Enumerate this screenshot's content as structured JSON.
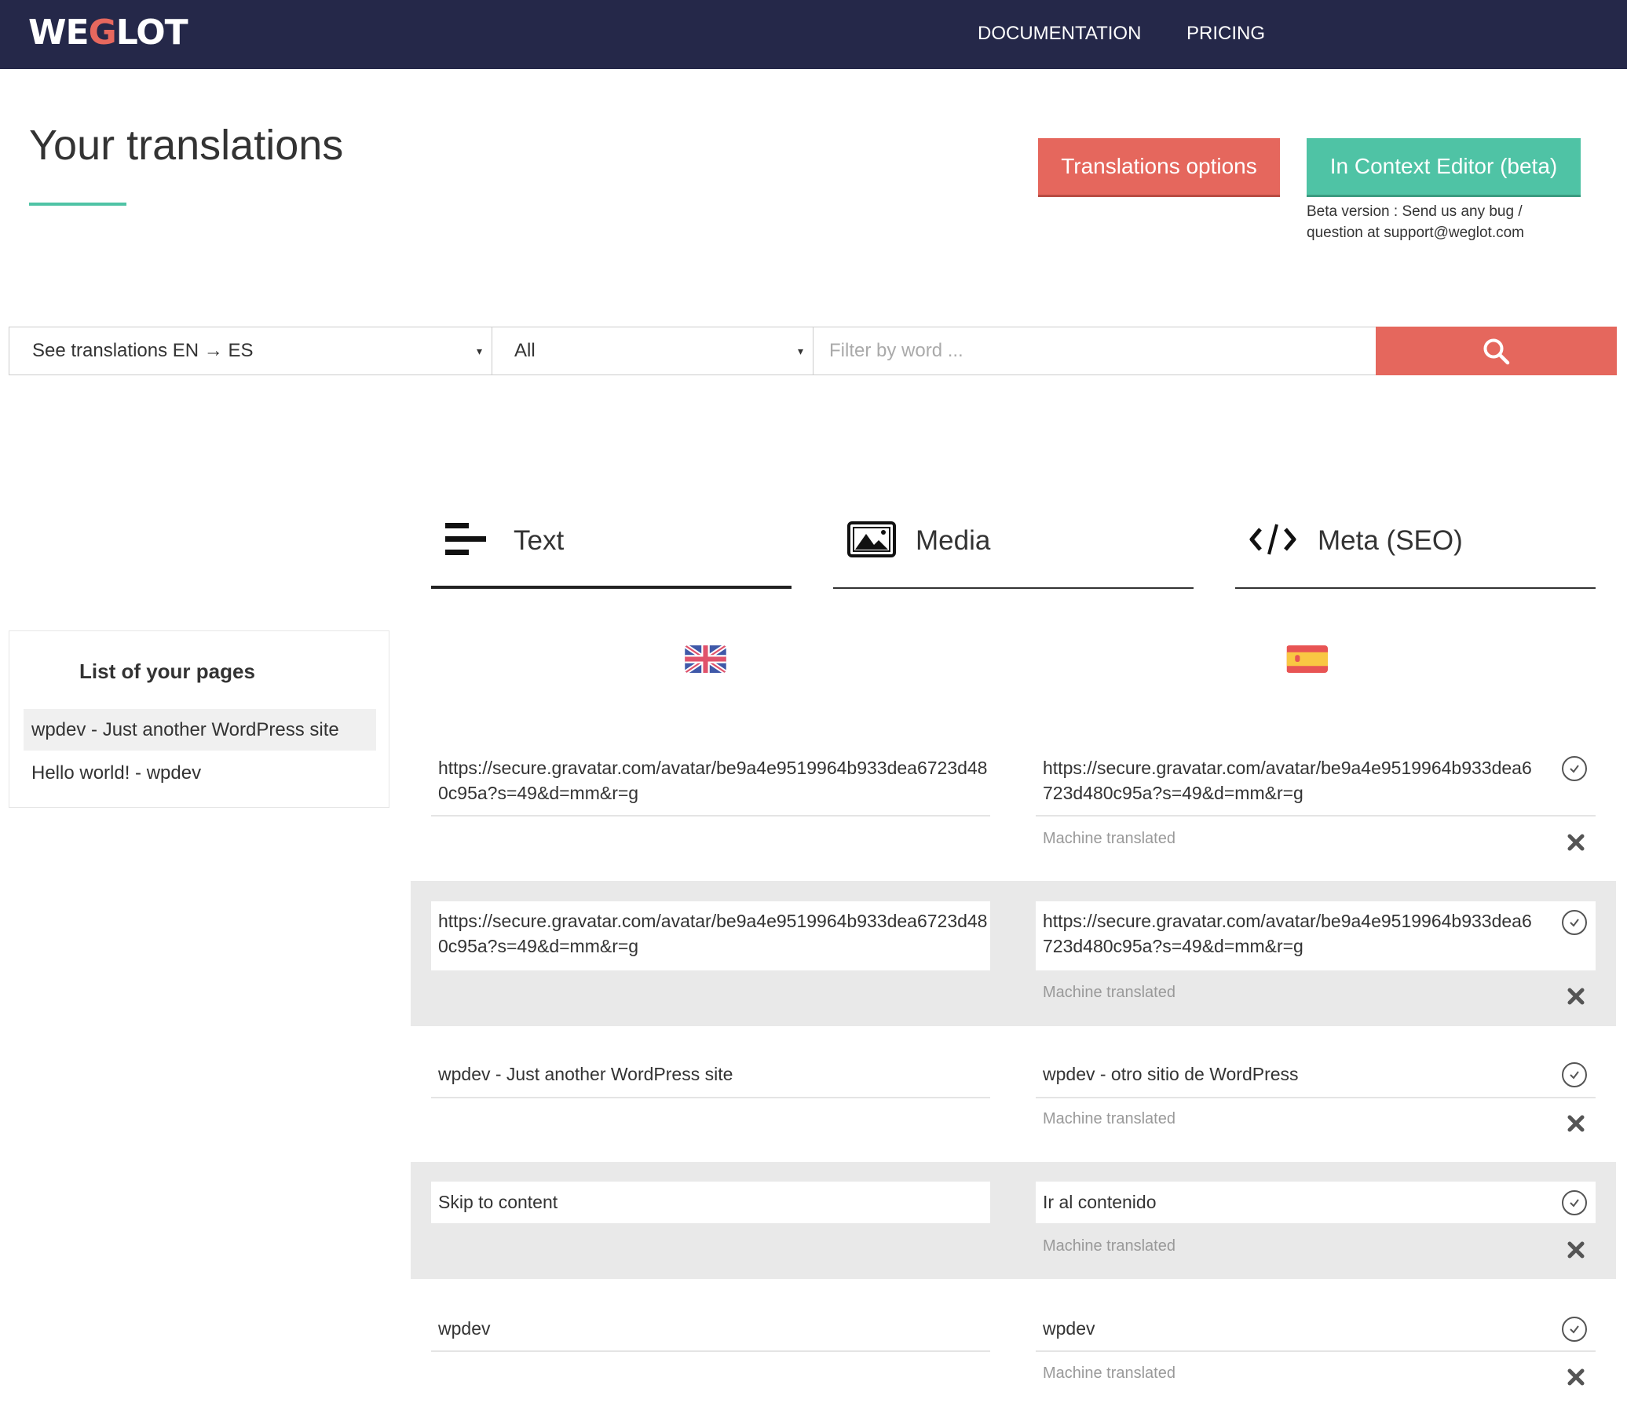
{
  "header": {
    "logo": {
      "part1": "WE",
      "part2": "G",
      "part3": "LOT"
    },
    "nav": [
      {
        "label": "DOCUMENTATION"
      },
      {
        "label": "PRICING"
      }
    ]
  },
  "page": {
    "title": "Your translations",
    "buttons": {
      "translations_options": "Translations options",
      "in_context_editor": "In Context Editor (beta)"
    },
    "beta_note": "Beta version : Send us any bug / question at support@weglot.com"
  },
  "filters": {
    "language_select": {
      "selected": "See translations EN → ES",
      "caret": "▾"
    },
    "type_select": {
      "selected": "All",
      "caret": "▾"
    },
    "word_filter": {
      "value": "",
      "placeholder": "Filter by word ..."
    },
    "search_icon": "search-icon"
  },
  "tabs": [
    {
      "label": "Text",
      "icon": "text-lines-icon",
      "active": true
    },
    {
      "label": "Media",
      "icon": "image-icon",
      "active": false
    },
    {
      "label": "Meta (SEO)",
      "icon": "code-icon",
      "active": false
    }
  ],
  "sidebar": {
    "title": "List of your pages",
    "items": [
      {
        "label": "wpdev - Just another WordPress site",
        "active": true
      },
      {
        "label": "Hello world! - wpdev",
        "active": false
      }
    ]
  },
  "languages": {
    "source": {
      "code": "EN",
      "flag": "uk-flag"
    },
    "target": {
      "code": "ES",
      "flag": "spain-flag"
    }
  },
  "translations": [
    {
      "source": "https://secure.gravatar.com/avatar/be9a4e9519964b933dea6723d480c95a?s=49&d=mm&r=g",
      "target": "https://secure.gravatar.com/avatar/be9a4e9519964b933dea6723d480c95a?s=49&d=mm&r=g",
      "status": "Machine translated"
    },
    {
      "source": "https://secure.gravatar.com/avatar/be9a4e9519964b933dea6723d480c95a?s=49&d=mm&r=g",
      "target": "https://secure.gravatar.com/avatar/be9a4e9519964b933dea6723d480c95a?s=49&d=mm&r=g",
      "status": "Machine translated"
    },
    {
      "source": "wpdev - Just another WordPress site",
      "target": "wpdev - otro sitio de WordPress",
      "status": "Machine translated"
    },
    {
      "source": "Skip to content",
      "target": "Ir al contenido",
      "status": "Machine translated"
    },
    {
      "source": "wpdev",
      "target": "wpdev",
      "status": "Machine translated"
    }
  ],
  "colors": {
    "header_bg": "#252849",
    "brand_red": "#e5675d",
    "brand_teal": "#4fc3a5"
  }
}
